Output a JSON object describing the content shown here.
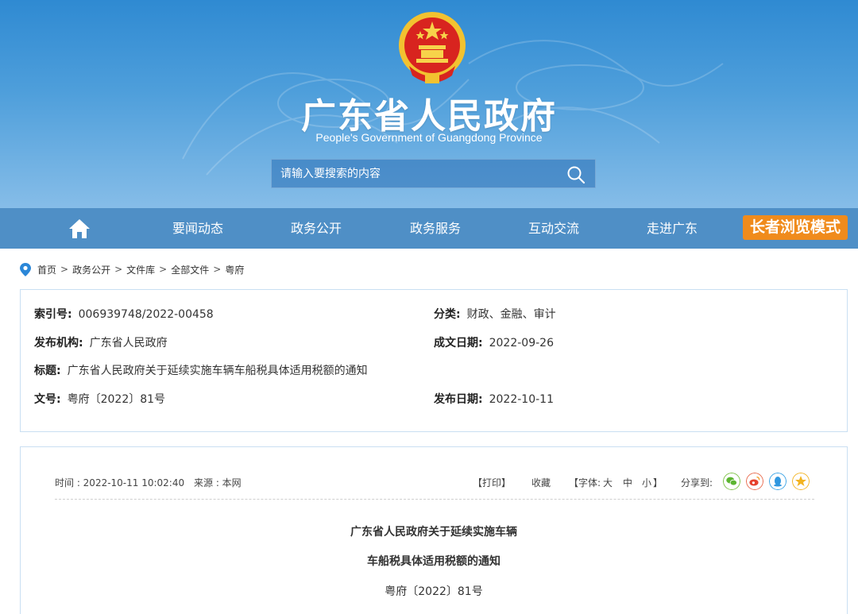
{
  "header": {
    "site_title": "广东省人民政府",
    "site_subtitle": "People's Government of Guangdong Province",
    "search_placeholder": "请输入要搜索的内容",
    "emblem_icon": "national-emblem-icon"
  },
  "nav": {
    "home_icon": "home-icon",
    "items": [
      "要闻动态",
      "政务公开",
      "政务服务",
      "互动交流",
      "走进广东"
    ],
    "elder_mode": "长者浏览模式",
    "elder_color": "#f08b1c",
    "bar_color": "#4f8fc6"
  },
  "breadcrumb": [
    "首页",
    "政务公开",
    "文件库",
    "全部文件",
    "粤府"
  ],
  "info": {
    "index_no_label": "索引号:",
    "index_no": "006939748/2022-00458",
    "category_label": "分类:",
    "category": "财政、金融、审计",
    "publisher_label": "发布机构:",
    "publisher": "广东省人民政府",
    "created_label": "成文日期:",
    "created": "2022-09-26",
    "title_label": "标题:",
    "title": "广东省人民政府关于延续实施车辆车船税具体适用税额的通知",
    "doc_no_label": "文号:",
    "doc_no": "粤府〔2022〕81号",
    "published_label": "发布日期:",
    "published": "2022-10-11"
  },
  "article": {
    "time": "时间 : 2022-10-11 10:02:40",
    "source": "来源 : 本网",
    "print": "【打印】",
    "favorite": "收藏",
    "font_label": "【字体:",
    "font_large": "大",
    "font_medium": "中",
    "font_small": "小",
    "font_close": "】",
    "share_label": "分享到:",
    "title_line1": "广东省人民政府关于延续实施车辆",
    "title_line2": "车船税具体适用税额的通知",
    "doc_no": "粤府〔2022〕81号"
  }
}
